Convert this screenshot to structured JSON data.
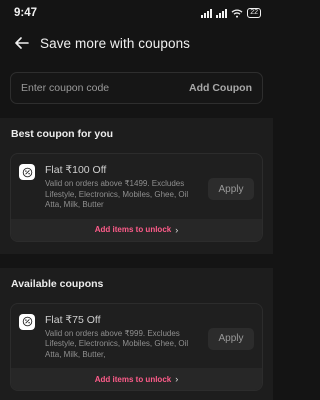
{
  "status_bar": {
    "time": "9:47",
    "battery": "22"
  },
  "header": {
    "title": "Save more with coupons"
  },
  "coupon_input": {
    "placeholder": "Enter coupon code",
    "add_label": "Add Coupon"
  },
  "best_section": {
    "title": "Best coupon for you",
    "coupon": {
      "title": "Flat ₹100  Off",
      "description": "Valid on orders above ₹1499. Excludes Lifestyle, Electronics, Mobiles, Ghee, Oil Atta, Milk, Butter",
      "apply_label": "Apply",
      "unlock_label": "Add items to unlock"
    }
  },
  "available_section": {
    "title": "Available coupons",
    "coupon": {
      "title": "Flat ₹75 Off",
      "description": "Valid on orders above ₹999. Excludes Lifestyle, Electronics, Mobiles, Ghee, Oil Atta, Milk, Butter,",
      "apply_label": "Apply",
      "unlock_label": "Add items to unlock"
    }
  },
  "colors": {
    "accent": "#ff5c8a",
    "background": "#141414",
    "section": "#1d1d1d"
  }
}
